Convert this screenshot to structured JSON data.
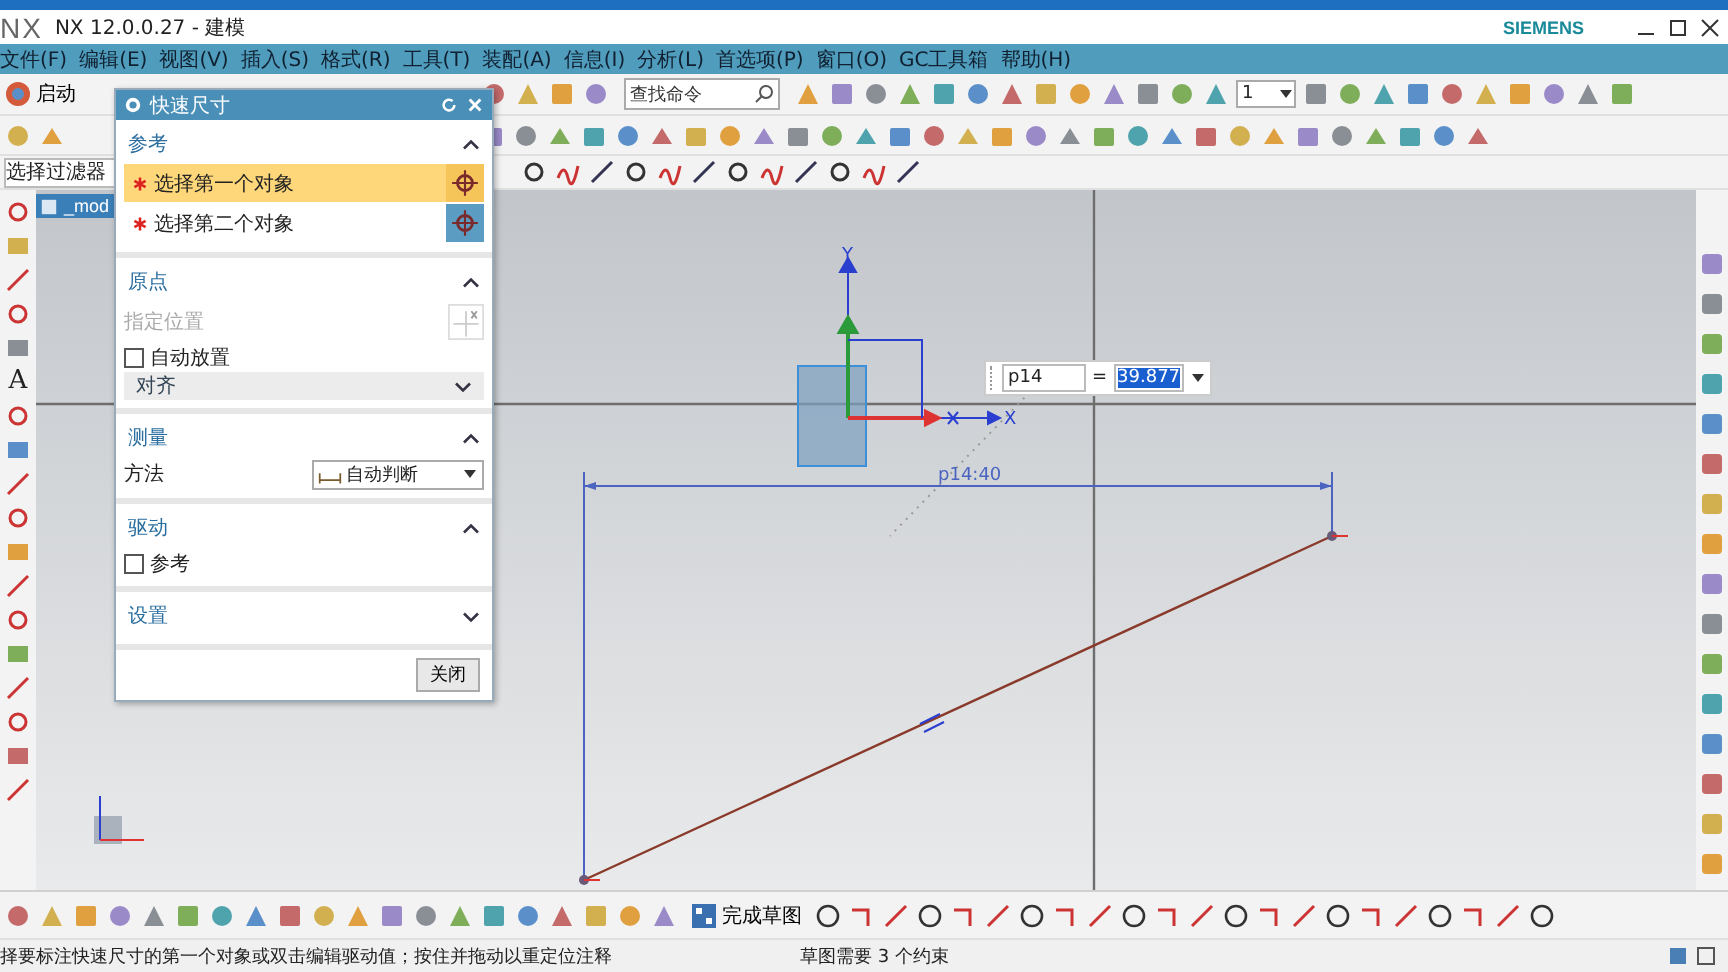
{
  "window": {
    "logo": "NX",
    "title": "NX 12.0.0.27 - 建模",
    "brand": "SIEMENS"
  },
  "menu": [
    "文件(F)",
    "编辑(E)",
    "视图(V)",
    "插入(S)",
    "格式(R)",
    "工具(T)",
    "装配(A)",
    "信息(I)",
    "分析(L)",
    "首选项(P)",
    "窗口(O)",
    "GC工具箱",
    "帮助(H)"
  ],
  "toolbar": {
    "start_label": "启动",
    "search_placeholder": "查找命令",
    "layer_value": "1",
    "filter_value": "选择过滤器"
  },
  "document_tab": "_mod",
  "left_toolbar_text": "A",
  "dialog": {
    "title": "快速尺寸",
    "close_button": "关闭",
    "sections": [
      {
        "title": "参考",
        "expanded": true,
        "rows": [
          {
            "kind": "select",
            "label": "选择第一个对象",
            "selected": true
          },
          {
            "kind": "select",
            "label": "选择第二个对象",
            "selected": false
          }
        ]
      },
      {
        "title": "原点",
        "expanded": true,
        "rows": [
          {
            "kind": "point",
            "label": "指定位置",
            "disabled": true
          },
          {
            "kind": "checkbox",
            "label": "自动放置",
            "checked": false
          },
          {
            "kind": "dropdown",
            "value": "对齐"
          }
        ]
      },
      {
        "title": "测量",
        "expanded": true,
        "rows": [
          {
            "kind": "method",
            "label": "方法",
            "value": "自动判断"
          }
        ]
      },
      {
        "title": "驱动",
        "expanded": true,
        "rows": [
          {
            "kind": "checkbox",
            "label": "参考",
            "checked": false
          }
        ]
      },
      {
        "title": "设置",
        "expanded": false
      }
    ]
  },
  "canvas": {
    "axis_y": "Y",
    "axis_x": "X",
    "dimension_label": "p14:40",
    "edit": {
      "name": "p14",
      "equals": "=",
      "value": "39.877"
    }
  },
  "bottom_toolbar": {
    "finish_sketch": "完成草图"
  },
  "status_bar": {
    "prompt": "择要标注快速尺寸的第一个对象或双击编辑驱动值；按住并拖动以重定位注释",
    "message": "草图需要 3 个约束"
  }
}
